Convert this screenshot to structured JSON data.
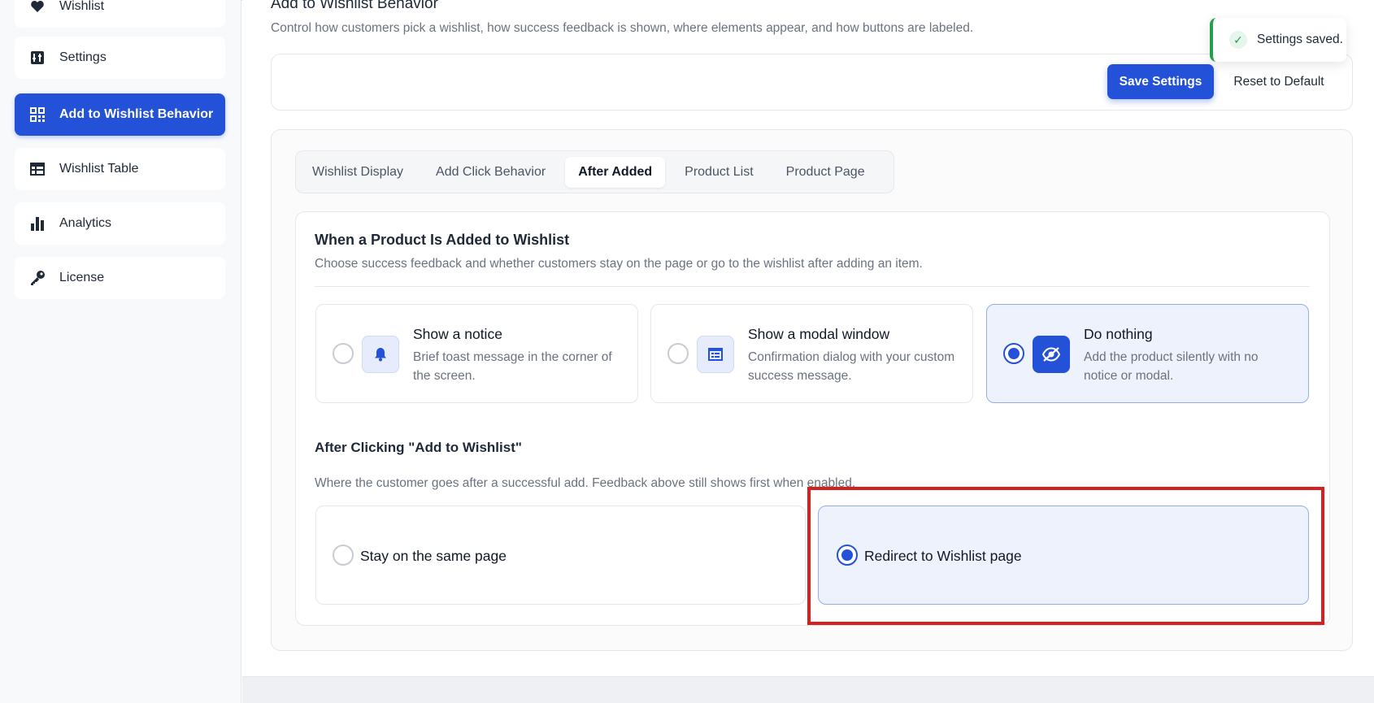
{
  "sidebar": {
    "items": [
      {
        "label": "Wishlist",
        "icon": "heart-icon"
      },
      {
        "label": "Settings",
        "icon": "settings-icon"
      },
      {
        "label": "Add to Wishlist Behavior",
        "icon": "qr-grid-icon",
        "active": true
      },
      {
        "label": "Wishlist Table",
        "icon": "table-icon"
      },
      {
        "label": "Analytics",
        "icon": "bar-chart-icon"
      },
      {
        "label": "License",
        "icon": "key-icon"
      }
    ]
  },
  "header": {
    "title": "Add to Wishlist Behavior",
    "description": "Control how customers pick a wishlist, how success feedback is shown, where elements appear, and how buttons are labeled."
  },
  "toolbar": {
    "save_label": "Save Settings",
    "reset_label": "Reset to Default"
  },
  "toast": {
    "message": "Settings saved.",
    "check": "✓",
    "accent": "#22a04b"
  },
  "tabs": [
    {
      "label": "Wishlist Display"
    },
    {
      "label": "Add Click Behavior"
    },
    {
      "label": "After Added",
      "active": true
    },
    {
      "label": "Product List"
    },
    {
      "label": "Product Page"
    }
  ],
  "feedback_section": {
    "title": "When a Product Is Added to Wishlist",
    "description": "Choose success feedback and whether customers stay on the page or go to the wishlist after adding an item.",
    "options": [
      {
        "title": "Show a notice",
        "description": "Brief toast message in the corner of the screen.",
        "icon": "bell-icon",
        "selected": false
      },
      {
        "title": "Show a modal window",
        "description": "Confirmation dialog with your custom success message.",
        "icon": "modal-window-icon",
        "selected": false
      },
      {
        "title": "Do nothing",
        "description": "Add the product silently with no notice or modal.",
        "icon": "eye-off-icon",
        "selected": true
      }
    ]
  },
  "redirect_section": {
    "title": "After Clicking \"Add to Wishlist\"",
    "description": "Where the customer goes after a successful add. Feedback above still shows first when enabled.",
    "options": [
      {
        "label": "Stay on the same page",
        "selected": false
      },
      {
        "label": "Redirect to Wishlist page",
        "selected": true
      }
    ]
  },
  "colors": {
    "accent": "#2352d8",
    "highlight": "#d91e1e"
  }
}
